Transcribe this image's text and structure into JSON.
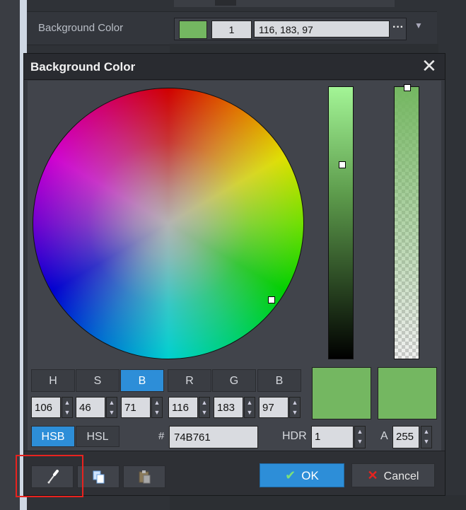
{
  "background": {
    "property_label": "Background Color",
    "swatch_color": "#74B761",
    "alpha_value": "1",
    "rgb_text": "116, 183, 97",
    "more_label": "···",
    "dropdown_icon": "chevron-down-icon"
  },
  "dialog": {
    "title": "Background Color",
    "close_icon": "close-icon",
    "current_color": "#74B761",
    "channels": [
      {
        "header": "H",
        "value": "106"
      },
      {
        "header": "S",
        "value": "46"
      },
      {
        "header": "B",
        "value": "71"
      },
      {
        "header": "R",
        "value": "116"
      },
      {
        "header": "G",
        "value": "183"
      },
      {
        "header": "B",
        "value": "97"
      }
    ],
    "active_channel": "B",
    "modes": {
      "hsb": "HSB",
      "hsl": "HSL",
      "active": "HSB"
    },
    "hex_label": "#",
    "hex_value": "74B761",
    "hdr_label": "HDR",
    "hdr_value": "1",
    "alpha_label": "A",
    "alpha_value": "255",
    "tools": [
      "eyedropper-icon",
      "copy-icon",
      "paste-icon"
    ],
    "ok_label": "OK",
    "cancel_label": "Cancel",
    "accent_color": "#2d8ed8",
    "highlight_color": "#e8231f"
  }
}
